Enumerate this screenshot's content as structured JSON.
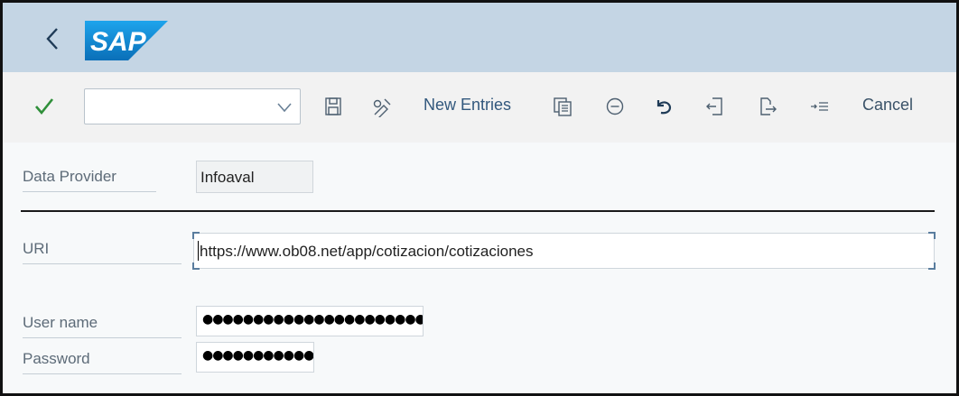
{
  "shell": {
    "logo_text": "SAP",
    "brand_color": "#1b8fd6"
  },
  "toolbar": {
    "okcode_value": "",
    "new_entries_label": "New Entries",
    "cancel_label": "Cancel",
    "icons": [
      "check-icon",
      "save-icon",
      "display-change-icon",
      "copy-icon",
      "delete-icon",
      "undo-icon",
      "previous-entry-icon",
      "next-entry-icon",
      "select-all-icon"
    ]
  },
  "form": {
    "data_provider_label": "Data Provider",
    "data_provider_value": "Infoaval",
    "uri_label": "URI",
    "uri_value": "https://www.ob08.net/app/cotizacion/cotizaciones",
    "username_label": "User name",
    "username_masked": "●●●●●●●●●●●●●●●●●●●●●●",
    "password_label": "Password",
    "password_masked": "●●●●●●●●●●●●"
  }
}
